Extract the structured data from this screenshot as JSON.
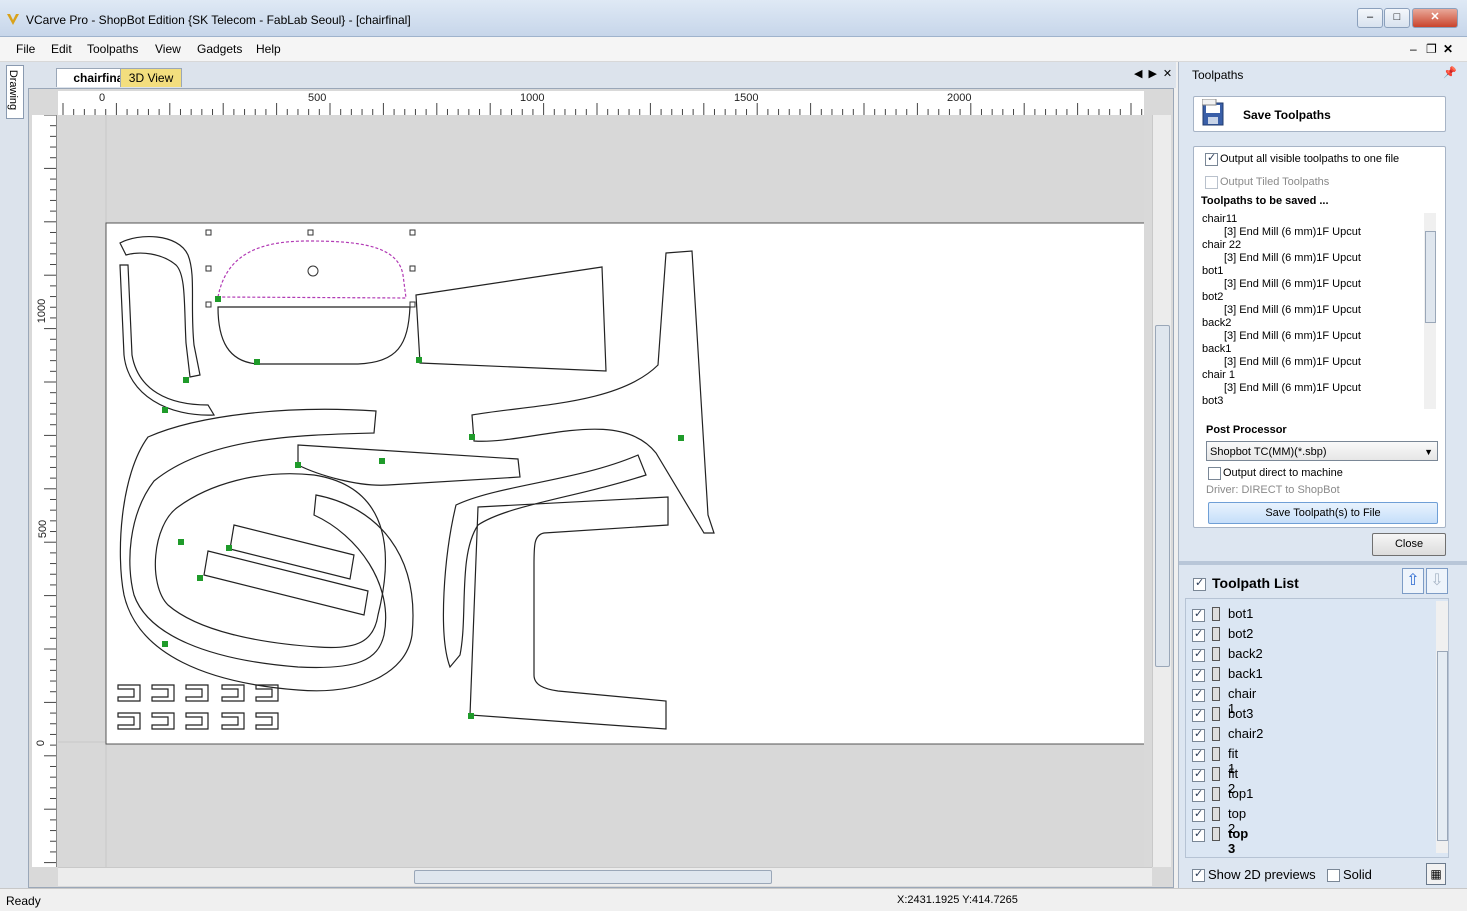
{
  "window": {
    "title": "VCarve Pro - ShopBot Edition {SK Telecom - FabLab Seoul} - [chairfinal]"
  },
  "menu": [
    "File",
    "Edit",
    "Toolpaths",
    "View",
    "Gadgets",
    "Help"
  ],
  "side_tab": {
    "label": "Drawing"
  },
  "tabs": {
    "active": "chairfinal",
    "other": "3D View"
  },
  "rulers": {
    "top_labels": [
      "0",
      "500",
      "1000",
      "1500",
      "2000"
    ],
    "left_labels": [
      "1000",
      "500",
      "0"
    ]
  },
  "panel": {
    "title": "Toolpaths",
    "save_card_label": "Save Toolpaths",
    "output_all_label": "Output all visible toolpaths to one file",
    "output_all_checked": true,
    "output_tiled_label": "Output Tiled Toolpaths",
    "to_be_saved_heading": "Toolpaths to be saved ...",
    "to_be_saved": [
      {
        "name": "chair11",
        "tool": "[3] End Mill (6 mm)1F Upcut"
      },
      {
        "name": "chair 22",
        "tool": "[3] End Mill (6 mm)1F Upcut"
      },
      {
        "name": "bot1",
        "tool": "[3] End Mill (6 mm)1F Upcut"
      },
      {
        "name": "bot2",
        "tool": "[3] End Mill (6 mm)1F Upcut"
      },
      {
        "name": "back2",
        "tool": "[3] End Mill (6 mm)1F Upcut"
      },
      {
        "name": "back1",
        "tool": "[3] End Mill (6 mm)1F Upcut"
      },
      {
        "name": "chair 1",
        "tool": "[3] End Mill (6 mm)1F Upcut"
      },
      {
        "name": "bot3",
        "tool": ""
      }
    ],
    "post_processor_heading": "Post Processor",
    "post_processor_value": "Shopbot TC(MM)(*.sbp)",
    "output_direct_label": "Output direct to machine",
    "driver_text": "Driver: DIRECT to ShopBot",
    "save_button": "Save Toolpath(s) to File",
    "close_button": "Close",
    "toolpath_list_heading": "Toolpath List",
    "toolpath_list": [
      "bot1",
      "bot2",
      "back2",
      "back1",
      "chair 1",
      "bot3",
      "chair2",
      "fit 1",
      "fit 2",
      "top1",
      "top 2",
      "top 3"
    ],
    "show_2d_label": "Show 2D previews",
    "show_2d_checked": true,
    "solid_label": "Solid",
    "solid_checked": false
  },
  "status": {
    "left": "Ready",
    "coords": "X:2431.1925 Y:414.7265"
  },
  "colors": {
    "accent": "#3f7fd0",
    "selection": "#b23ab5",
    "node": "#1f9b2a"
  }
}
